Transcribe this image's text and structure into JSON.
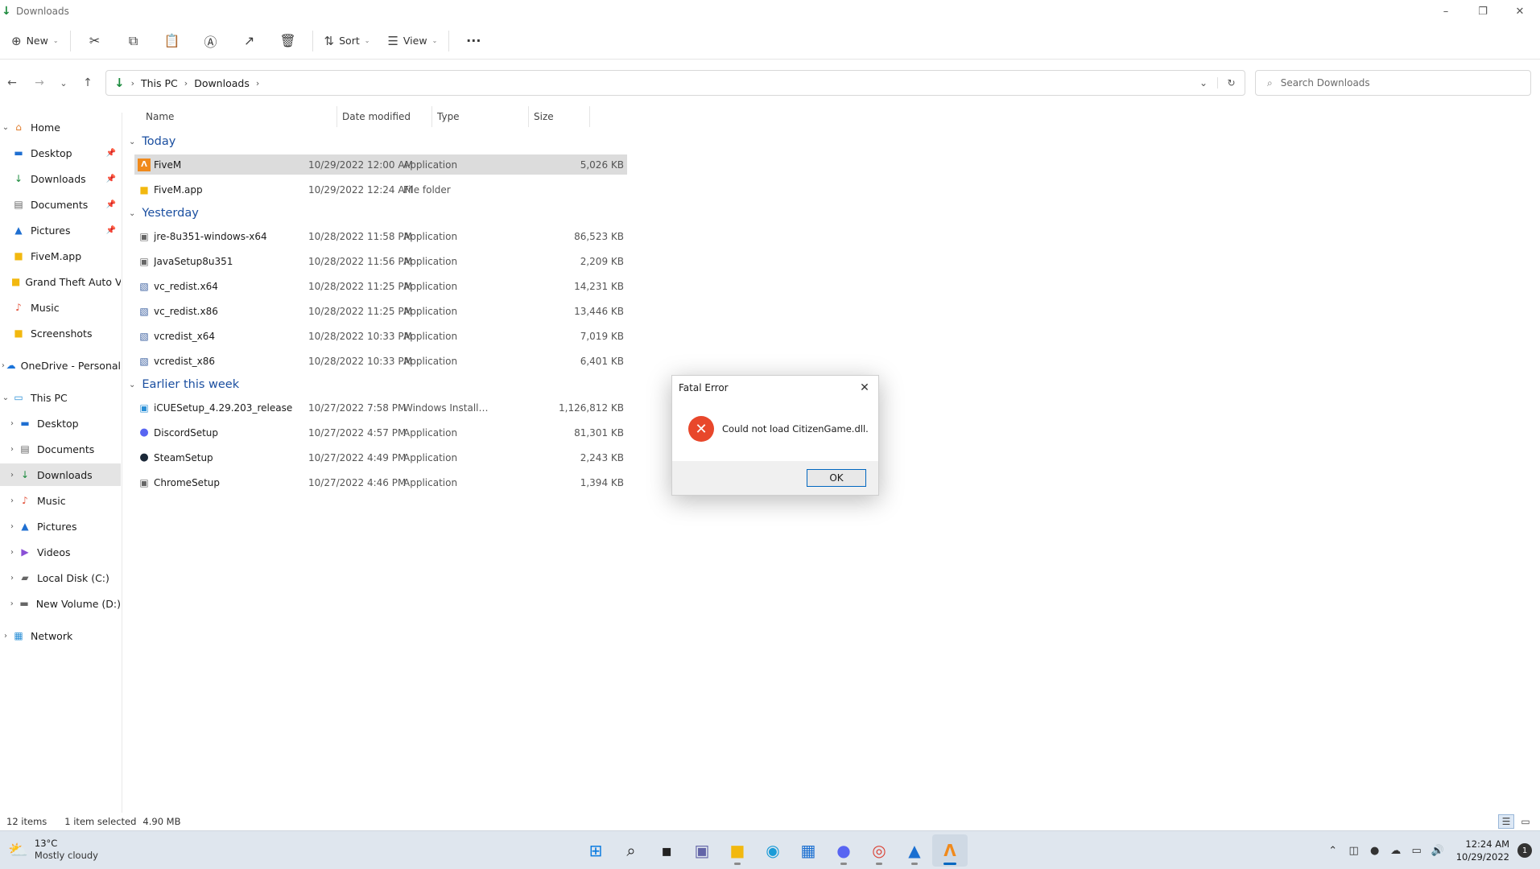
{
  "window": {
    "title": "Downloads",
    "controls": {
      "minimize": "–",
      "maximize": "❐",
      "close": "✕"
    }
  },
  "toolbar": {
    "new_label": "New",
    "sort_label": "Sort",
    "view_label": "View",
    "more_label": "···"
  },
  "address": {
    "crumbs": [
      "This PC",
      "Downloads"
    ],
    "search_placeholder": "Search Downloads"
  },
  "sidebar": {
    "items": [
      {
        "label": "Home"
      },
      {
        "label": "Desktop"
      },
      {
        "label": "Downloads"
      },
      {
        "label": "Documents"
      },
      {
        "label": "Pictures"
      },
      {
        "label": "FiveM.app"
      },
      {
        "label": "Grand Theft Auto V"
      },
      {
        "label": "Music"
      },
      {
        "label": "Screenshots"
      },
      {
        "label": "OneDrive - Personal"
      },
      {
        "label": "This PC"
      },
      {
        "label": "Desktop"
      },
      {
        "label": "Documents"
      },
      {
        "label": "Downloads"
      },
      {
        "label": "Music"
      },
      {
        "label": "Pictures"
      },
      {
        "label": "Videos"
      },
      {
        "label": "Local Disk (C:)"
      },
      {
        "label": "New Volume (D:)"
      },
      {
        "label": "Network"
      }
    ]
  },
  "columns": {
    "name": "Name",
    "date": "Date modified",
    "type": "Type",
    "size": "Size"
  },
  "groups": [
    {
      "label": "Today"
    },
    {
      "label": "Yesterday"
    },
    {
      "label": "Earlier this week"
    }
  ],
  "files": [
    {
      "name": "FiveM",
      "date": "10/29/2022 12:00 AM",
      "type": "Application",
      "size": "5,026 KB"
    },
    {
      "name": "FiveM.app",
      "date": "10/29/2022 12:24 AM",
      "type": "File folder",
      "size": ""
    },
    {
      "name": "jre-8u351-windows-x64",
      "date": "10/28/2022 11:58 PM",
      "type": "Application",
      "size": "86,523 KB"
    },
    {
      "name": "JavaSetup8u351",
      "date": "10/28/2022 11:56 PM",
      "type": "Application",
      "size": "2,209 KB"
    },
    {
      "name": "vc_redist.x64",
      "date": "10/28/2022 11:25 PM",
      "type": "Application",
      "size": "14,231 KB"
    },
    {
      "name": "vc_redist.x86",
      "date": "10/28/2022 11:25 PM",
      "type": "Application",
      "size": "13,446 KB"
    },
    {
      "name": "vcredist_x64",
      "date": "10/28/2022 10:33 PM",
      "type": "Application",
      "size": "7,019 KB"
    },
    {
      "name": "vcredist_x86",
      "date": "10/28/2022 10:33 PM",
      "type": "Application",
      "size": "6,401 KB"
    },
    {
      "name": "iCUESetup_4.29.203_release",
      "date": "10/27/2022 7:58 PM",
      "type": "Windows Installer ...",
      "size": "1,126,812 KB"
    },
    {
      "name": "DiscordSetup",
      "date": "10/27/2022 4:57 PM",
      "type": "Application",
      "size": "81,301 KB"
    },
    {
      "name": "SteamSetup",
      "date": "10/27/2022 4:49 PM",
      "type": "Application",
      "size": "2,243 KB"
    },
    {
      "name": "ChromeSetup",
      "date": "10/27/2022 4:46 PM",
      "type": "Application",
      "size": "1,394 KB"
    }
  ],
  "dialog": {
    "title": "Fatal Error",
    "message": "Could not load CitizenGame.dll.",
    "ok_label": "OK"
  },
  "status": {
    "item_count": "12 items",
    "selection": "1 item selected",
    "size": "4.90 MB"
  },
  "taskbar": {
    "temperature": "13°C",
    "condition": "Mostly cloudy",
    "time": "12:24 AM",
    "date": "10/29/2022",
    "notifications": "1"
  }
}
